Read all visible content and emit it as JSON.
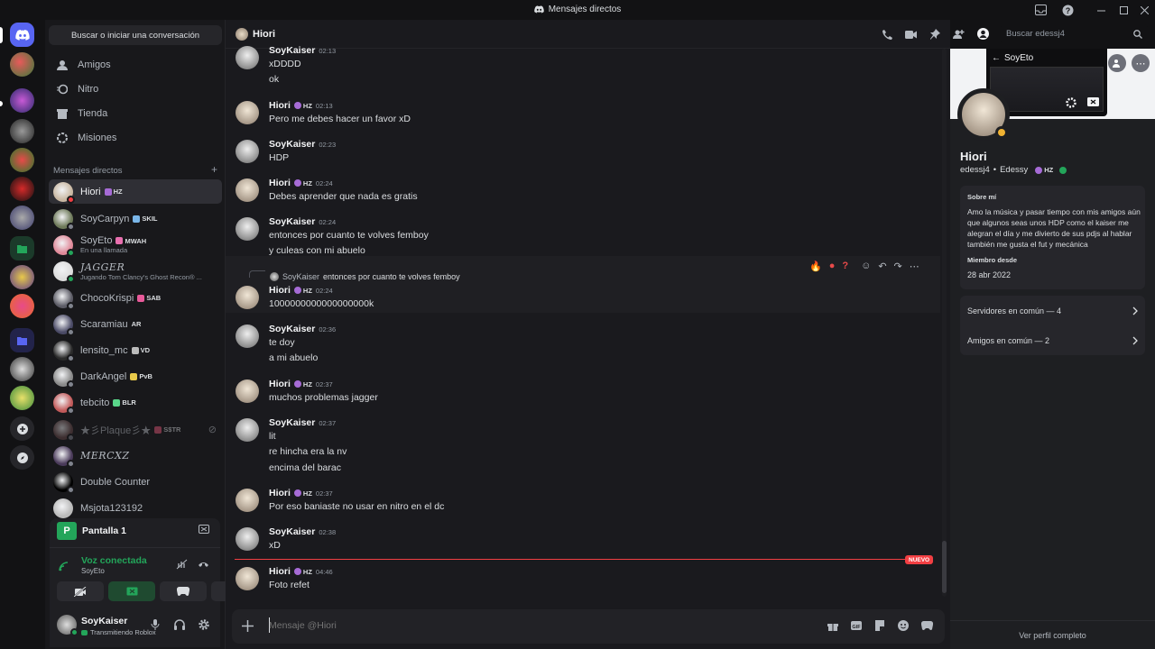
{
  "window": {
    "title": "Mensajes directos"
  },
  "sidebar": {
    "search_label": "Buscar o iniciar una conversación",
    "nav": [
      {
        "label": "Amigos",
        "icon": "friends-icon"
      },
      {
        "label": "Nitro",
        "icon": "nitro-icon"
      },
      {
        "label": "Tienda",
        "icon": "shop-icon"
      },
      {
        "label": "Misiones",
        "icon": "quests-icon"
      }
    ],
    "dm_header": "Mensajes directos",
    "dms": [
      {
        "name": "Hiori",
        "tag": "HZ",
        "tag_color": "#a66bd6",
        "sub": "",
        "status": "dnd",
        "avatar": "#c9b8a3"
      },
      {
        "name": "SoyCarpyn",
        "tag": "SKIL",
        "tag_color": "#7ab6e8",
        "sub": "",
        "status": "offline",
        "avatar": "#6e7a5a"
      },
      {
        "name": "SoyEto",
        "tag": "MWAH",
        "tag_color": "#e86fae",
        "sub": "En una llamada",
        "status": "online",
        "avatar": "#e08a9a"
      },
      {
        "name": "JAGGER",
        "tag": "",
        "tag_color": "",
        "sub": "Jugando Tom Clancy's Ghost Recon® ...",
        "status": "online",
        "avatar": "#ddd"
      },
      {
        "name": "ChocoKrispi",
        "tag": "SAB",
        "tag_color": "#e85a9a",
        "sub": "",
        "status": "offline",
        "avatar": "#5c5c66"
      },
      {
        "name": "Scaramiau",
        "tag": "AR",
        "tag_color": "",
        "sub": "",
        "status": "offline",
        "avatar": "#4a4a66"
      },
      {
        "name": "lensito_mc",
        "tag": "VD",
        "tag_color": "#bbb",
        "sub": "",
        "status": "offline",
        "avatar": "#2a2a2a"
      },
      {
        "name": "DarkAngel",
        "tag": "PvB",
        "tag_color": "#e8c94a",
        "sub": "",
        "status": "offline",
        "avatar": "#8a8a8a"
      },
      {
        "name": "tebcito",
        "tag": "BLR",
        "tag_color": "#5ad68a",
        "sub": "",
        "status": "offline",
        "avatar": "#c25a5a"
      },
      {
        "name": "★彡Plaque彡★",
        "tag": "S$TR",
        "tag_color": "#e85a7a",
        "sub": "",
        "status": "offline",
        "avatar": "#6a4a4a"
      },
      {
        "name": "MERCXZ",
        "tag": "",
        "tag_color": "",
        "sub": "",
        "status": "offline",
        "avatar": "#4a3a5a"
      },
      {
        "name": "Double Counter",
        "tag": "",
        "tag_color": "",
        "sub": "",
        "status": "offline",
        "avatar": "#000"
      },
      {
        "name": "Msjota123192",
        "tag": "",
        "tag_color": "",
        "sub": "",
        "status": "offline",
        "avatar": "#bbb"
      }
    ]
  },
  "voice_panel": {
    "stream_title": "Pantalla 1",
    "voice_status": "Voz conectada",
    "channel": "SoyEto"
  },
  "user_panel": {
    "name": "SoyKaiser",
    "status": "Transmitiendo Roblox"
  },
  "chat": {
    "header_name": "Hiori",
    "search_placeholder": "Buscar edessj4",
    "input_placeholder": "Mensaje @Hiori",
    "new_label": "NUEVO",
    "reply_preview": {
      "author": "SoyKaiser",
      "text": "entonces por cuanto te volves femboy"
    },
    "messages": [
      {
        "author": "SoyKaiser",
        "time": "02:13",
        "hz": false,
        "lines": [
          "xDDDD",
          "ok"
        ]
      },
      {
        "author": "Hiori",
        "time": "02:13",
        "hz": true,
        "lines": [
          "Pero me debes hacer un favor xD"
        ]
      },
      {
        "author": "SoyKaiser",
        "time": "02:23",
        "hz": false,
        "lines": [
          "HDP"
        ]
      },
      {
        "author": "Hiori",
        "time": "02:24",
        "hz": true,
        "lines": [
          "Debes aprender que nada es gratis"
        ]
      },
      {
        "author": "SoyKaiser",
        "time": "02:24",
        "hz": false,
        "lines": [
          "entonces por cuanto te volves femboy",
          "y culeas con mi abuelo"
        ]
      },
      {
        "author": "Hiori",
        "time": "02:24",
        "hz": true,
        "lines": [
          "1000000000000000000k"
        ]
      },
      {
        "author": "SoyKaiser",
        "time": "02:36",
        "hz": false,
        "lines": [
          "te doy",
          "a mi abuelo"
        ]
      },
      {
        "author": "Hiori",
        "time": "02:37",
        "hz": true,
        "lines": [
          "muchos problemas jagger"
        ]
      },
      {
        "author": "SoyKaiser",
        "time": "02:37",
        "hz": false,
        "lines": [
          "lit",
          "re hincha era la nv",
          "encima del barac"
        ]
      },
      {
        "author": "Hiori",
        "time": "02:37",
        "hz": true,
        "lines": [
          "Por eso baniaste no usar en nitro en el dc"
        ]
      },
      {
        "author": "SoyKaiser",
        "time": "02:38",
        "hz": false,
        "lines": [
          "xD"
        ]
      },
      {
        "author": "Hiori",
        "time": "04:46",
        "hz": true,
        "lines": [
          "Foto refet"
        ]
      }
    ]
  },
  "profile": {
    "display_name": "Hiori",
    "username": "edessj4",
    "pronoun": "Edessy",
    "tag": "HZ",
    "stream_overlay_title": "SoyEto",
    "about_title": "Sobre mí",
    "about_text": "Amo la música y pasar tiempo con mis amigos aún que algunos seas unos HDP como el kaiser me alegran el día y me divierto de sus pdjs al hablar  también me gusta el fut y mecánica",
    "member_since_title": "Miembro desde",
    "member_since": "28 abr 2022",
    "servers_common": "Servidores en común — 4",
    "friends_common": "Amigos en común — 2",
    "view_full": "Ver perfil completo"
  },
  "colors": {
    "accent": "#5865f2",
    "online": "#23a55a",
    "dnd": "#f23f43",
    "new": "#f23f43",
    "hz": "#a66bd6"
  }
}
